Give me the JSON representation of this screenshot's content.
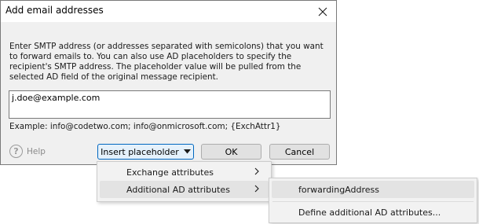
{
  "dialog": {
    "title": "Add email addresses",
    "description": "Enter SMTP address (or addresses separated with semicolons) that you want to forward emails to. You can also use AD placeholders to specify the recipient's SMTP address. The placeholder value will be pulled from the selected AD field of the original message recipient.",
    "address_value": "j.doe@example.com",
    "example": "Example: info@codetwo.com; info@onmicrosoft.com; {ExchAttr1}",
    "help_label": "Help",
    "help_glyph": "?",
    "buttons": {
      "insert_placeholder": "Insert placeholder",
      "ok": "OK",
      "cancel": "Cancel"
    }
  },
  "menu": {
    "items": [
      {
        "label": "Exchange attributes",
        "has_submenu": true
      },
      {
        "label": "Additional AD attributes",
        "has_submenu": true,
        "highlighted": true
      }
    ]
  },
  "submenu": {
    "items": [
      {
        "label": "forwardingAddress",
        "highlighted": true
      },
      {
        "label": "Define additional AD attributes..."
      }
    ]
  },
  "icons": {
    "close": "close-icon",
    "help": "help-circle-icon",
    "dropdown": "triangle-down-icon",
    "submenu_arrow": "chevron-right-icon"
  },
  "colors": {
    "focus_border": "#0067c0",
    "focus_fill": "#e5f1fb",
    "dialog_bg": "#f0f0f0",
    "menu_bg": "#f2f2f2",
    "menu_highlight": "#e3e3e3"
  }
}
